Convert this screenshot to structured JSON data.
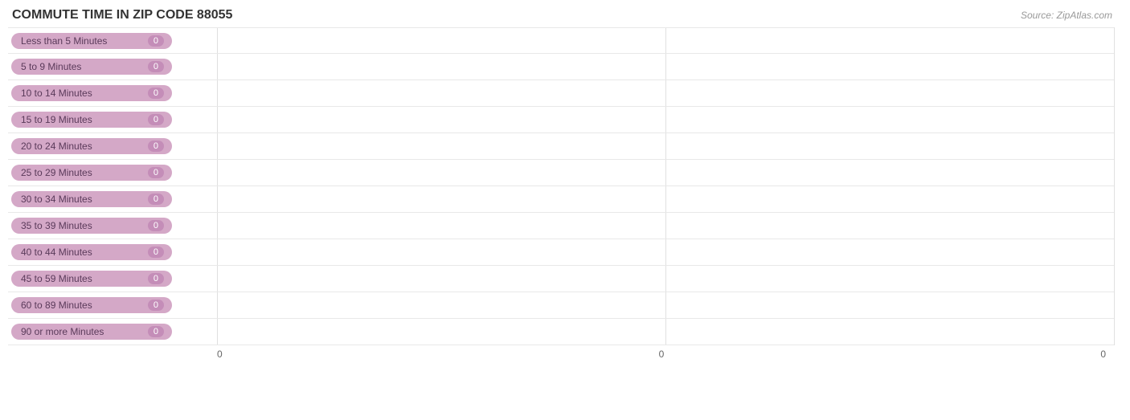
{
  "title": "COMMUTE TIME IN ZIP CODE 88055",
  "source": "Source: ZipAtlas.com",
  "bars": [
    {
      "label": "Less than 5 Minutes",
      "value": 0
    },
    {
      "label": "5 to 9 Minutes",
      "value": 0
    },
    {
      "label": "10 to 14 Minutes",
      "value": 0
    },
    {
      "label": "15 to 19 Minutes",
      "value": 0
    },
    {
      "label": "20 to 24 Minutes",
      "value": 0
    },
    {
      "label": "25 to 29 Minutes",
      "value": 0
    },
    {
      "label": "30 to 34 Minutes",
      "value": 0
    },
    {
      "label": "35 to 39 Minutes",
      "value": 0
    },
    {
      "label": "40 to 44 Minutes",
      "value": 0
    },
    {
      "label": "45 to 59 Minutes",
      "value": 0
    },
    {
      "label": "60 to 89 Minutes",
      "value": 0
    },
    {
      "label": "90 or more Minutes",
      "value": 0
    }
  ],
  "xaxis": {
    "labels": [
      "0",
      "0",
      "0"
    ]
  }
}
